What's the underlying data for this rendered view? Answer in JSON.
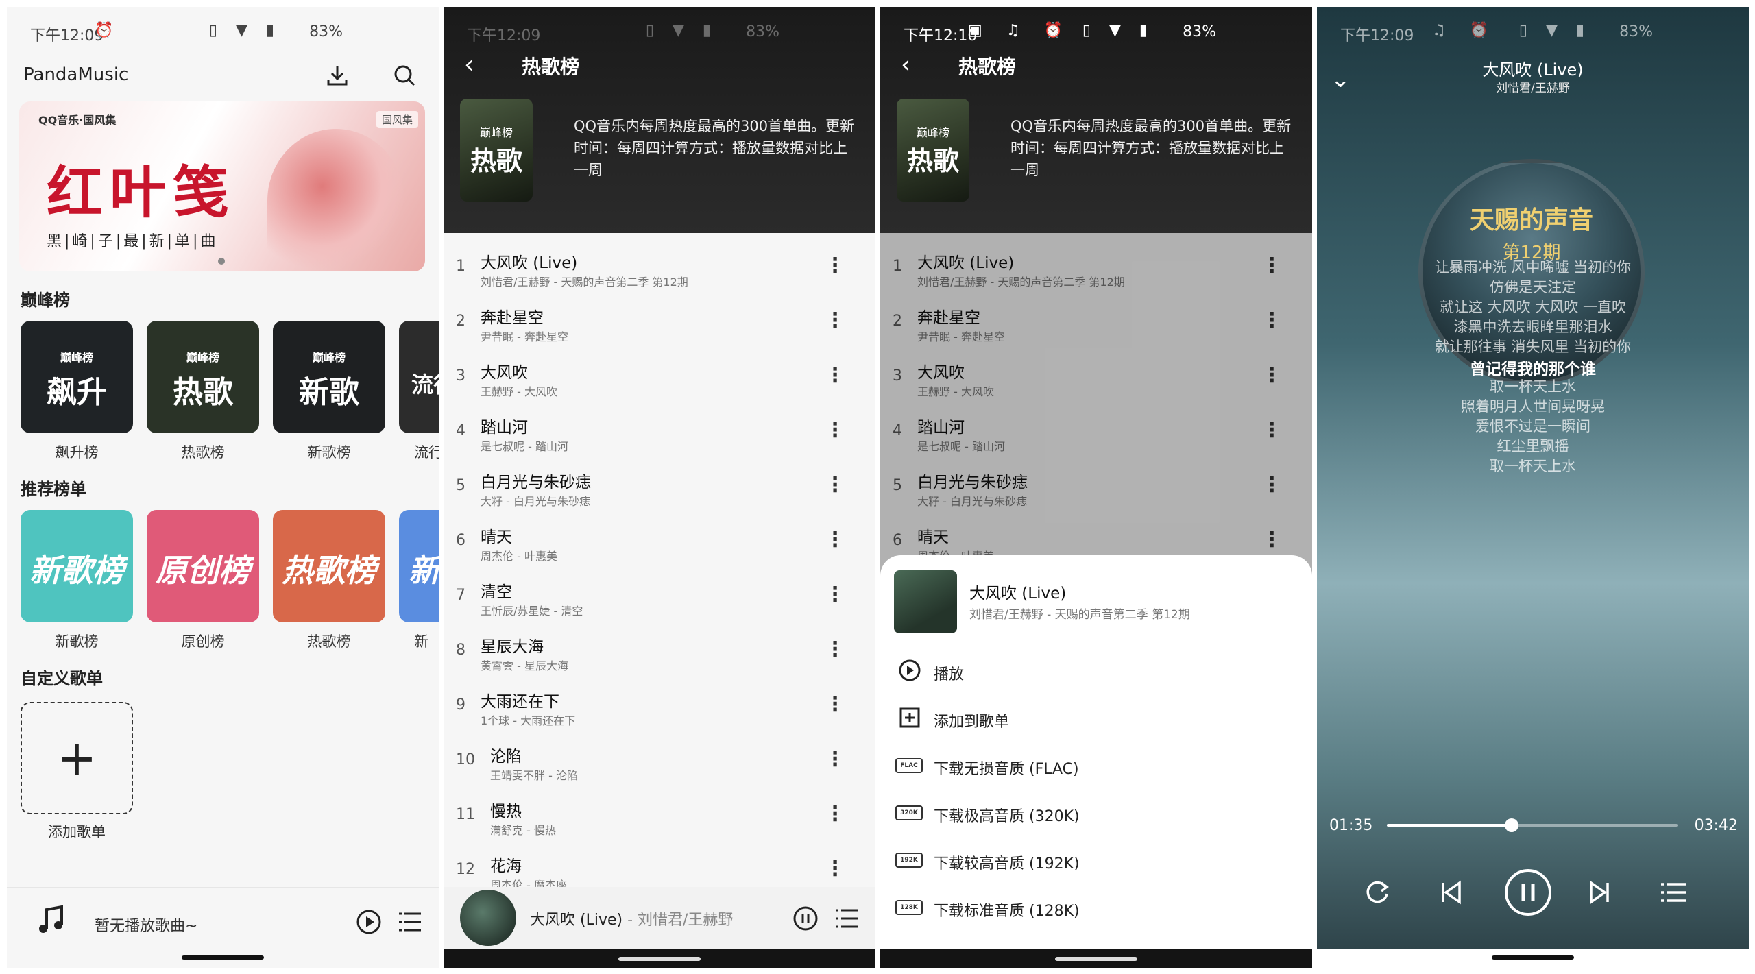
{
  "status": {
    "p1": {
      "time": "下午12:09",
      "battery": "83%"
    },
    "p2": {
      "time": "下午12:09",
      "battery": "83%"
    },
    "p3": {
      "time": "下午12:10",
      "battery": "83%"
    },
    "p4": {
      "time": "下午12:09",
      "battery": "83%"
    }
  },
  "home": {
    "app_title": "PandaMusic",
    "banner": {
      "brand": "QQ音乐·国风集",
      "tag": "国风集",
      "title": "红叶笺",
      "subtitle": "黑|崎|子|最|新|单|曲"
    },
    "peak_section": "巅峰榜",
    "peak_tiles": [
      {
        "mini": "巅峰榜",
        "big": "飙升",
        "label": "飙升榜",
        "color": "#1f2326"
      },
      {
        "mini": "巅峰榜",
        "big": "热歌",
        "label": "热歌榜",
        "color": "#2a3327"
      },
      {
        "mini": "巅峰榜",
        "big": "新歌",
        "label": "新歌榜",
        "color": "#1e2022"
      },
      {
        "mini": "",
        "big": "流行",
        "label": "流行",
        "color": "#2c2c2c"
      }
    ],
    "rec_section": "推荐榜单",
    "rec_tiles": [
      {
        "big": "新歌榜",
        "label": "新歌榜",
        "color": "#4fc4bf"
      },
      {
        "big": "原创榜",
        "label": "原创榜",
        "color": "#e05a78"
      },
      {
        "big": "热歌榜",
        "label": "热歌榜",
        "color": "#d8684a"
      },
      {
        "big": "新",
        "label": "新",
        "color": "#5a8de0"
      }
    ],
    "custom_section": "自定义歌单",
    "add_label": "添加歌单",
    "empty_player": "暂无播放歌曲~"
  },
  "chart": {
    "title": "热歌榜",
    "cover_mini": "巅峰榜",
    "cover_big": "热歌",
    "description": "QQ音乐内每周热度最高的300首单曲。更新时间：每周四计算方式：播放量数据对比上一周",
    "songs": [
      {
        "no": "1",
        "name": "大风吹 (Live)",
        "sub": "刘惜君/王赫野 - 天赐的声音第二季 第12期"
      },
      {
        "no": "2",
        "name": "奔赴星空",
        "sub": "尹昔眠 - 奔赴星空"
      },
      {
        "no": "3",
        "name": "大风吹",
        "sub": "王赫野 - 大风吹"
      },
      {
        "no": "4",
        "name": "踏山河",
        "sub": "是七叔呢 - 踏山河"
      },
      {
        "no": "5",
        "name": "白月光与朱砂痣",
        "sub": "大籽 - 白月光与朱砂痣"
      },
      {
        "no": "6",
        "name": "晴天",
        "sub": "周杰伦 - 叶惠美"
      },
      {
        "no": "7",
        "name": "清空",
        "sub": "王忻辰/苏星婕 - 清空"
      },
      {
        "no": "8",
        "name": "星辰大海",
        "sub": "黄霄雲 - 星辰大海"
      },
      {
        "no": "9",
        "name": "大雨还在下",
        "sub": "1个球 - 大雨还在下"
      },
      {
        "no": "10",
        "name": "沦陷",
        "sub": "王靖雯不胖 - 沦陷"
      },
      {
        "no": "11",
        "name": "慢热",
        "sub": "满舒克 - 慢热"
      },
      {
        "no": "12",
        "name": "花海",
        "sub": "周杰伦 - 魔杰座"
      }
    ],
    "mini_title": "大风吹 (Live)",
    "mini_artist": " - 刘惜君/王赫野"
  },
  "sheet": {
    "title": "大风吹 (Live)",
    "subtitle": "刘惜君/王赫野 - 天赐的声音第二季 第12期",
    "actions": [
      {
        "label": "播放",
        "icon": "play-circle-icon"
      },
      {
        "label": "添加到歌单",
        "icon": "add-box-icon"
      },
      {
        "label": "下载无损音质 (FLAC)",
        "badge": "FLAC"
      },
      {
        "label": "下载极高音质 (320K)",
        "badge": "320K"
      },
      {
        "label": "下载较高音质 (192K)",
        "badge": "192K"
      },
      {
        "label": "下载标准音质 (128K)",
        "badge": "128K"
      }
    ]
  },
  "player": {
    "title": "大风吹 (Live)",
    "artist": "刘惜君/王赫野",
    "disc_text": "天赐的声音",
    "disc_sub": "第12期",
    "lyrics": [
      "让暴雨冲洗 风中唏嘘 当初的你",
      "仿佛是天注定",
      "就让这 大风吹 大风吹 一直吹",
      "漆黑中洗去眼眸里那泪水",
      "就让那往事 消失风里 当初的你",
      "曾记得我的那个谁",
      "取一杯天上水",
      "照着明月人世间晃呀晃",
      "爱恨不过是一瞬间",
      "红尘里飘摇",
      "取一杯天上水"
    ],
    "current_index": 5,
    "elapsed": "01:35",
    "duration": "03:42",
    "progress": 0.43
  }
}
